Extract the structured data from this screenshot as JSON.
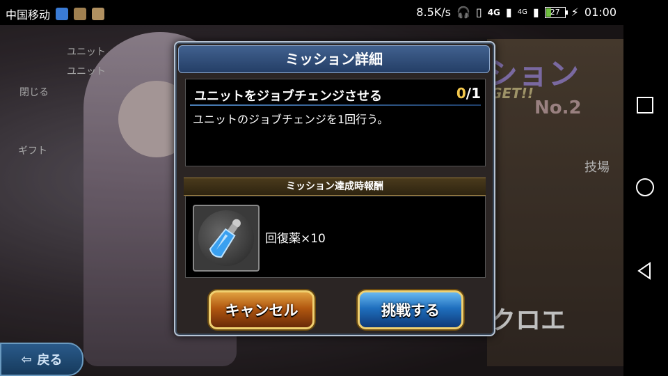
{
  "statusbar": {
    "carrier": "中国移动",
    "speed": "8.5K/s",
    "network_a": "4G",
    "network_b": "4G",
    "battery": "27",
    "time": "01:00",
    "icons": [
      "shield-icon",
      "app-icon",
      "app-icon",
      "headphones-icon",
      "vibrate-icon",
      "signal-icon",
      "signal-icon",
      "battery-icon",
      "charging-icon"
    ]
  },
  "background": {
    "title_partial": "ション",
    "get_text": "GET!!",
    "no_label": "No.2",
    "right_tag": "技場",
    "character_name": "クロエ",
    "left_label_1": "閉じる",
    "left_label_2": "ギフト",
    "left_label_3": "ユニット",
    "left_label_4": "ユニット",
    "back_button": "戻る"
  },
  "dialog": {
    "title": "ミッション詳細",
    "mission_name": "ユニットをジョブチェンジさせる",
    "progress_current": "0",
    "progress_total": "/1",
    "description": "ユニットのジョブチェンジを1回行う。",
    "reward_header": "ミッション達成時報酬",
    "reward_label": "回復薬×10",
    "reward_icon": "potion-icon",
    "cancel_button": "キャンセル",
    "challenge_button": "挑戦する"
  },
  "navbar": {
    "icons": [
      "recent-apps-icon",
      "home-icon",
      "back-icon"
    ]
  },
  "colors": {
    "accent_gold": "#f3c74c",
    "title_bar": "#2f4f80",
    "cancel_button": "#b25810",
    "challenge_button": "#1f6fbe"
  }
}
